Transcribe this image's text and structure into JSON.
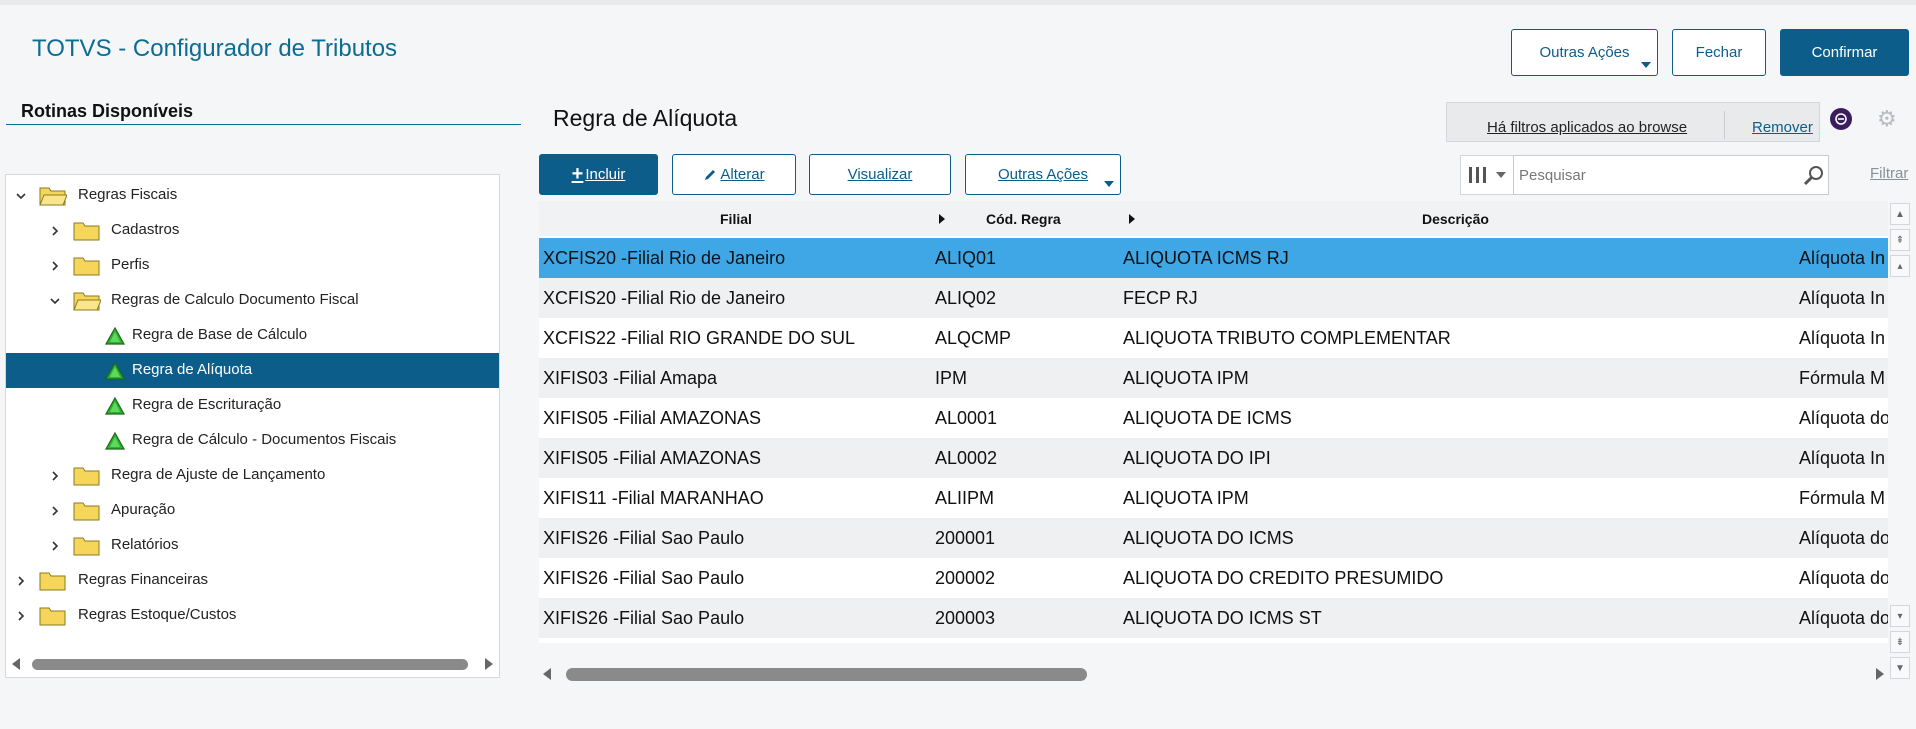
{
  "app": {
    "title": "TOTVS - Configurador de Tributos"
  },
  "header": {
    "outras_acoes": "Outras Ações",
    "fechar": "Fechar",
    "confirmar": "Confirmar"
  },
  "sidebar": {
    "title": "Rotinas Disponíveis",
    "items": [
      {
        "label": "Regras Fiscais"
      },
      {
        "label": "Cadastros"
      },
      {
        "label": "Perfis"
      },
      {
        "label": "Regras de Calculo Documento Fiscal"
      },
      {
        "label": "Regra de Base de Cálculo"
      },
      {
        "label": "Regra de Alíquota"
      },
      {
        "label": "Regra de Escrituração"
      },
      {
        "label": "Regra de Cálculo - Documentos Fiscais"
      },
      {
        "label": "Regra de Ajuste de Lançamento"
      },
      {
        "label": "Apuração"
      },
      {
        "label": "Relatórios"
      },
      {
        "label": "Regras Financeiras"
      },
      {
        "label": "Regras Estoque/Custos"
      }
    ]
  },
  "main": {
    "title": "Regra de Alíquota",
    "filter_text": "Há filtros aplicados ao browse",
    "filter_remove": "Remover",
    "toolbar": {
      "incluir": "Incluir",
      "alterar": "Alterar",
      "visualizar": "Visualizar",
      "outras_acoes": "Outras Ações"
    },
    "search_placeholder": "Pesquisar",
    "filtrar": "Filtrar"
  },
  "grid": {
    "headers": [
      "Filial",
      "Cód. Regra",
      "Descrição"
    ],
    "rows": [
      {
        "filial": "XCFIS20 -Filial Rio de Janeiro",
        "cod": "ALIQ01",
        "desc": "ALIQUOTA ICMS RJ",
        "extra": "Alíquota In"
      },
      {
        "filial": "XCFIS20 -Filial Rio de Janeiro",
        "cod": "ALIQ02",
        "desc": "FECP RJ",
        "extra": "Alíquota In"
      },
      {
        "filial": "XCFIS22 -Filial RIO GRANDE DO SUL",
        "cod": "ALQCMP",
        "desc": "ALIQUOTA TRIBUTO COMPLEMENTAR",
        "extra": "Alíquota In"
      },
      {
        "filial": "XIFIS03 -Filial Amapa",
        "cod": "IPM",
        "desc": "ALIQUOTA IPM",
        "extra": "Fórmula M"
      },
      {
        "filial": "XIFIS05 -Filial AMAZONAS",
        "cod": "AL0001",
        "desc": "ALIQUOTA DE ICMS",
        "extra": "Alíquota do"
      },
      {
        "filial": "XIFIS05 -Filial AMAZONAS",
        "cod": "AL0002",
        "desc": "ALIQUOTA DO IPI",
        "extra": "Alíquota In"
      },
      {
        "filial": "XIFIS11 -Filial MARANHAO",
        "cod": "ALIIPM",
        "desc": "ALIQUOTA IPM",
        "extra": "Fórmula M"
      },
      {
        "filial": "XIFIS26 -Filial Sao Paulo",
        "cod": "200001",
        "desc": "ALIQUOTA DO ICMS",
        "extra": "Alíquota do"
      },
      {
        "filial": "XIFIS26 -Filial Sao Paulo",
        "cod": "200002",
        "desc": "ALIQUOTA DO CREDITO PRESUMIDO",
        "extra": "Alíquota do"
      },
      {
        "filial": "XIFIS26 -Filial Sao Paulo",
        "cod": "200003",
        "desc": "ALIQUOTA DO ICMS ST",
        "extra": "Alíquota do"
      }
    ]
  },
  "colors": {
    "brand": "#0c5d8a",
    "title_blue": "#0c6c94",
    "selected_row": "#3fa7e6",
    "folder_yellow": "#f5d65a",
    "status_green": "#2fb12f"
  },
  "icons": {
    "expanded": "chevron-down-icon",
    "collapsed": "chevron-right-icon",
    "folder": "folder-icon",
    "rule": "green-triangle-icon",
    "search": "magnifier-icon",
    "settings": "gear-icon"
  }
}
